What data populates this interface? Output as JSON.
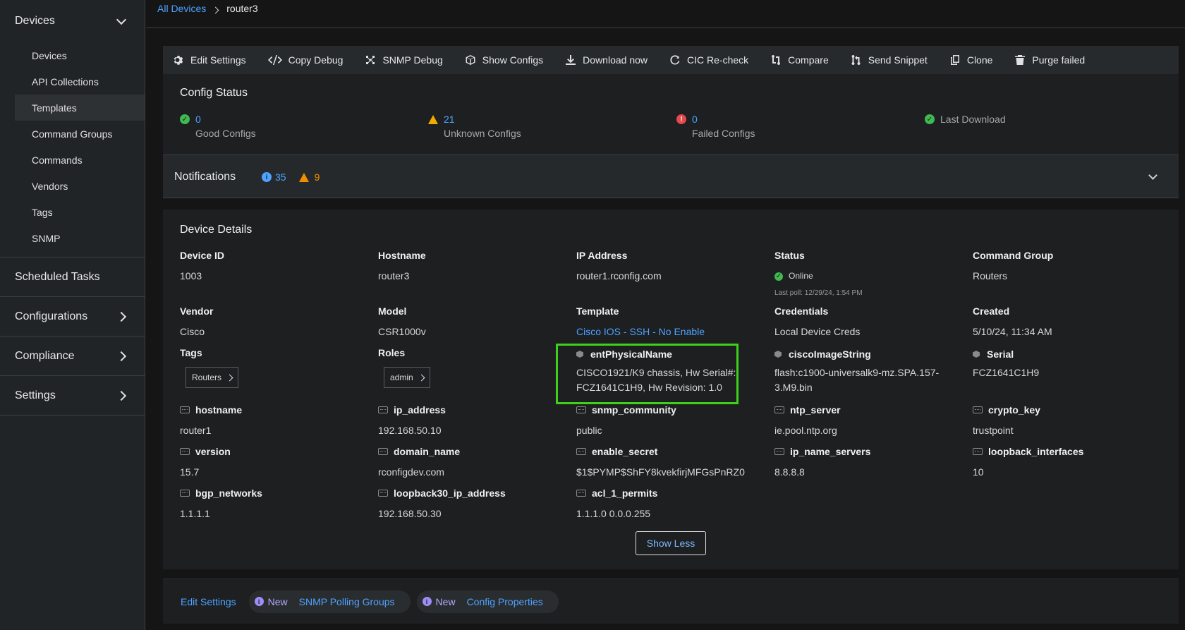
{
  "breadcrumb": {
    "root": "All Devices",
    "current": "router3"
  },
  "sidebar": {
    "devices_label": "Devices",
    "items": [
      "Devices",
      "API Collections",
      "Templates",
      "Command Groups",
      "Commands",
      "Vendors",
      "Tags",
      "SNMP"
    ],
    "sections": [
      "Scheduled Tasks",
      "Configurations",
      "Compliance",
      "Settings"
    ]
  },
  "toolbar": {
    "edit_settings": "Edit Settings",
    "copy_debug": "Copy Debug",
    "snmp_debug": "SNMP Debug",
    "show_configs": "Show Configs",
    "download_now": "Download now",
    "cic_recheck": "CIC Re-check",
    "compare": "Compare",
    "send_snippet": "Send Snippet",
    "clone": "Clone",
    "purge_failed": "Purge failed"
  },
  "config_status": {
    "title": "Config Status",
    "good": {
      "value": "0",
      "label": "Good Configs"
    },
    "unknown": {
      "value": "21",
      "label": "Unknown Configs"
    },
    "failed": {
      "value": "0",
      "label": "Failed Configs"
    },
    "last_download": "Last Download"
  },
  "notifications": {
    "title": "Notifications",
    "info_count": "35",
    "warning_count": "9"
  },
  "device_details": {
    "title": "Device Details",
    "device_id": {
      "label": "Device ID",
      "value": "1003"
    },
    "hostname": {
      "label": "Hostname",
      "value": "router3"
    },
    "ip_address": {
      "label": "IP Address",
      "value": "router1.rconfig.com"
    },
    "status": {
      "label": "Status",
      "value": "Online",
      "last_poll": "Last poll: 12/29/24, 1:54 PM"
    },
    "command_group": {
      "label": "Command Group",
      "value": "Routers"
    },
    "vendor": {
      "label": "Vendor",
      "value": "Cisco"
    },
    "model": {
      "label": "Model",
      "value": "CSR1000v"
    },
    "template": {
      "label": "Template",
      "value": "Cisco IOS - SSH - No Enable"
    },
    "credentials": {
      "label": "Credentials",
      "value": "Local Device Creds"
    },
    "created": {
      "label": "Created",
      "value": "5/10/24, 11:34 AM"
    },
    "tags": {
      "label": "Tags",
      "chip": "Routers"
    },
    "roles": {
      "label": "Roles",
      "chip": "admin"
    },
    "ent_physical_name": {
      "label": "entPhysicalName",
      "value": "CISCO1921/K9 chassis, Hw Serial#: FCZ1641C1H9, Hw Revision: 1.0"
    },
    "cisco_image_string": {
      "label": "ciscoImageString",
      "value": "flash:c1900-universalk9-mz.SPA.157-3.M9.bin"
    },
    "serial": {
      "label": "Serial",
      "value": "FCZ1641C1H9"
    },
    "vars": [
      {
        "label": "hostname",
        "value": "router1"
      },
      {
        "label": "ip_address",
        "value": "192.168.50.10"
      },
      {
        "label": "snmp_community",
        "value": "public"
      },
      {
        "label": "ntp_server",
        "value": "ie.pool.ntp.org"
      },
      {
        "label": "crypto_key",
        "value": "trustpoint"
      },
      {
        "label": "version",
        "value": "15.7"
      },
      {
        "label": "domain_name",
        "value": "rconfigdev.com"
      },
      {
        "label": "enable_secret",
        "value": "$1$PYMP$ShFY8kvekfirjMFGsPnRZ0"
      },
      {
        "label": "ip_name_servers",
        "value": "8.8.8.8"
      },
      {
        "label": "loopback_interfaces",
        "value": "10"
      },
      {
        "label": "bgp_networks",
        "value": "1.1.1.1"
      },
      {
        "label": "loopback30_ip_address",
        "value": "192.168.50.30"
      },
      {
        "label": "acl_1_permits",
        "value": "1.1.1.0 0.0.0.255"
      }
    ],
    "show_less": "Show Less"
  },
  "footer": {
    "edit_settings": "Edit Settings",
    "snmp": {
      "badge": "New",
      "label": "SNMP Polling Groups"
    },
    "config_props": {
      "badge": "New",
      "label": "Config Properties"
    }
  },
  "colors": {
    "accent": "#4da3ff",
    "success": "#3fb950",
    "warning": "#f0ab00",
    "danger": "#e5484d",
    "highlight": "#3dd11c"
  }
}
